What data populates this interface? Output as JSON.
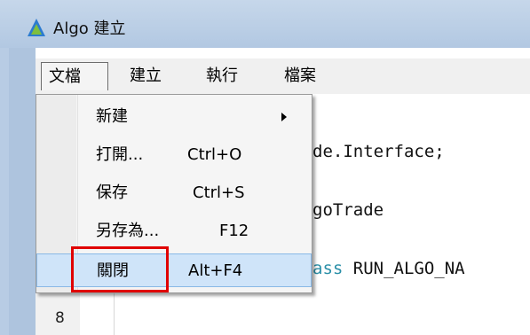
{
  "window": {
    "title": "Algo 建立"
  },
  "menubar": {
    "items": [
      "文檔",
      "建立",
      "執行",
      "檔案"
    ]
  },
  "dropdown": {
    "items": [
      {
        "label": "新建",
        "shortcut": ""
      },
      {
        "label": "打開...",
        "shortcut": "Ctrl+O"
      },
      {
        "label": "保存",
        "shortcut": "Ctrl+S"
      },
      {
        "label": "另存為...",
        "shortcut": "F12"
      },
      {
        "label": "關閉",
        "shortcut": "Alt+F4"
      }
    ],
    "highlighted": "關閉"
  },
  "editor": {
    "line_number": "8",
    "code": {
      "line1": "de.Interface;",
      "line2": "goTrade",
      "line3_kw": "ass",
      "line3_rest": " RUN_ALGO_NA"
    }
  },
  "colors": {
    "highlight": "#cfe4f9",
    "annotation": "#e00000",
    "titlebar": "#c6d7ea"
  }
}
